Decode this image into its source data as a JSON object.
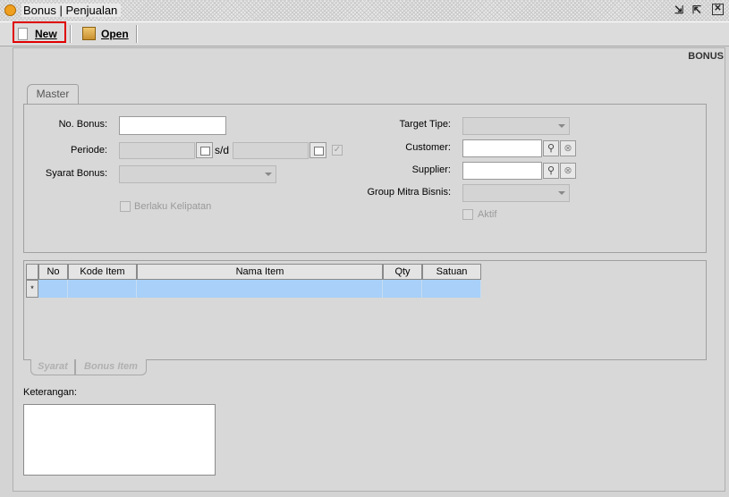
{
  "window": {
    "title": "Bonus | Penjualan"
  },
  "toolbar": {
    "new_label": "New",
    "open_label": "Open"
  },
  "page": {
    "heading": "BONUS"
  },
  "master": {
    "tab_label": "Master",
    "no_bonus_label": "No. Bonus:",
    "no_bonus_value": "",
    "periode_label": "Periode:",
    "periode_from": "",
    "periode_sep": "s/d",
    "periode_to": "",
    "syarat_bonus_label": "Syarat Bonus:",
    "syarat_bonus_value": "",
    "berlaku_kelipatan_label": "Berlaku Kelipatan",
    "target_tipe_label": "Target Tipe:",
    "target_tipe_value": "",
    "customer_label": "Customer:",
    "customer_value": "",
    "supplier_label": "Supplier:",
    "supplier_value": "",
    "group_mitra_label": "Group Mitra Bisnis:",
    "group_mitra_value": "",
    "aktif_label": "Aktif"
  },
  "grid": {
    "columns": [
      "No",
      "Kode Item",
      "Nama Item",
      "Qty",
      "Satuan"
    ],
    "new_row_indicator": "*"
  },
  "bottom_tabs": {
    "syarat": "Syarat",
    "bonus_item": "Bonus Item"
  },
  "keterangan": {
    "label": "Keterangan:",
    "value": ""
  }
}
